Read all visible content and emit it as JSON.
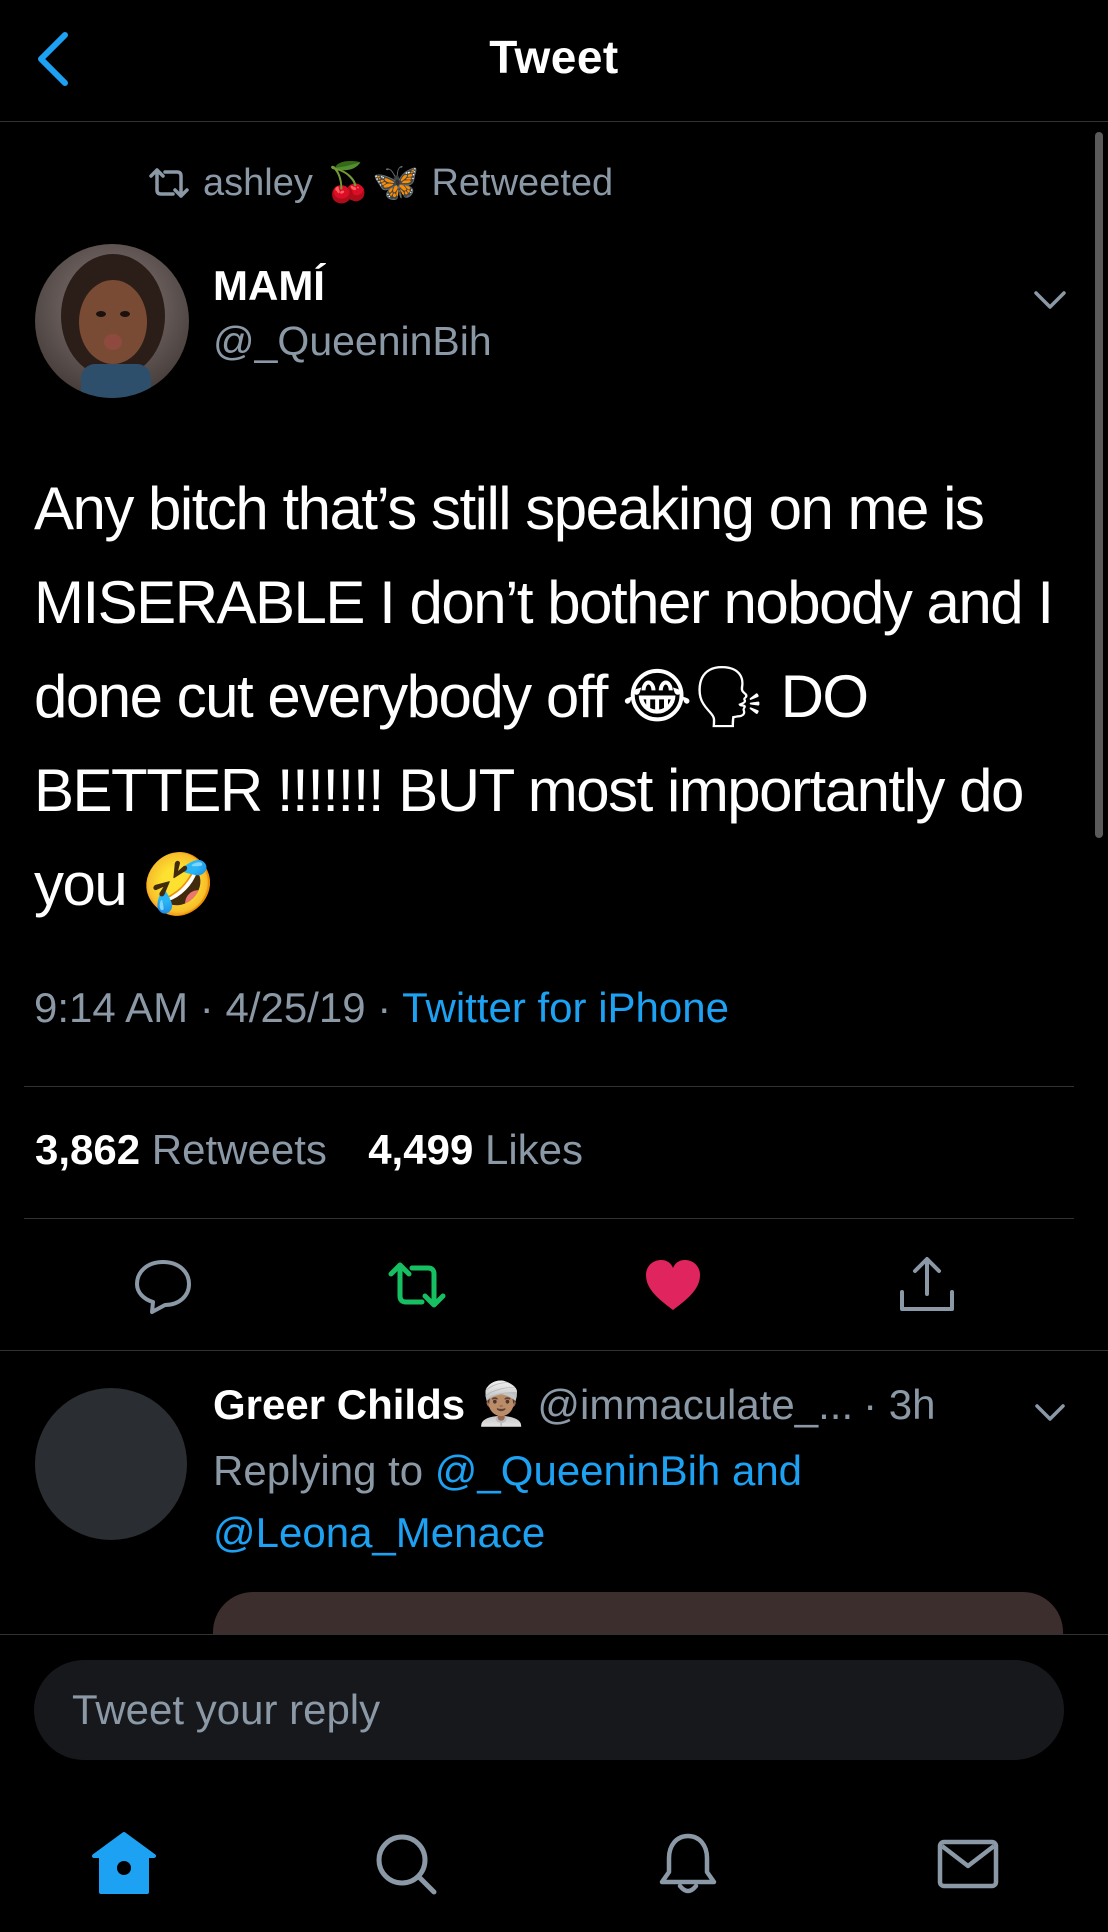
{
  "header": {
    "title": "Tweet",
    "back_icon": "chevron-left-icon"
  },
  "retweet_context": {
    "icon": "retweet-icon",
    "user": "ashley",
    "emoji": "🍒🦋",
    "label": "Retweeted"
  },
  "tweet": {
    "author_name": "MAMÍ",
    "author_handle": "@_QueeninBih",
    "text": "Any bitch that’s still speaking on me is MISERABLE I don’t bother nobody and I done cut everybody off 😂🗣 DO BETTER !!!!!!! BUT most importantly do you 🤣",
    "time": "9:14 AM",
    "date": "4/25/19",
    "source": "Twitter for iPhone",
    "retweet_count": "3,862",
    "retweet_label": "Retweets",
    "like_count": "4,499",
    "like_label": "Likes"
  },
  "actions": {
    "reply_icon": "reply-bubble-icon",
    "retweet_icon": "retweet-icon",
    "like_icon": "heart-icon",
    "share_icon": "share-icon"
  },
  "reply": {
    "name": "Greer Childs",
    "name_emoji": "👳🏽‍♂️",
    "handle": "@immaculate_...",
    "time": "· 3h",
    "replying_label": "Replying to",
    "mention_1": "@_QueeninBih",
    "conjunction": "and",
    "mention_2": "@Leona_Menace"
  },
  "compose": {
    "placeholder": "Tweet your reply"
  },
  "tab_bar": {
    "home_icon": "home-icon",
    "search_icon": "search-icon",
    "notifications_icon": "bell-icon",
    "messages_icon": "mail-icon"
  },
  "colors": {
    "accent": "#1da1f2",
    "retweet_green": "#17bf63",
    "like_red": "#e0245e",
    "secondary_text": "#8b98a5",
    "background": "#000000"
  }
}
